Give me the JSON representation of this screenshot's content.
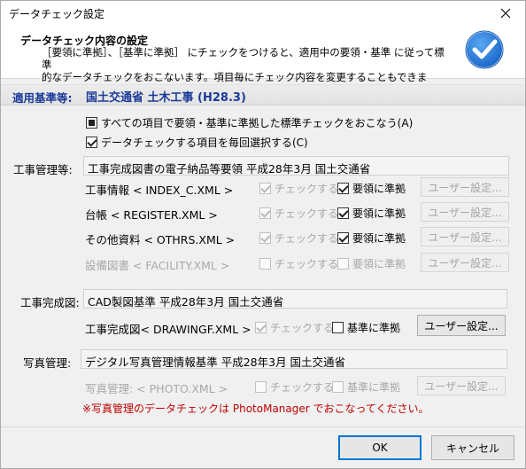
{
  "window": {
    "title": "データチェック設定"
  },
  "header": {
    "title": "データチェック内容の設定",
    "desc_line1": "［要領に準拠］、［基準に準拠］ にチェックをつけると、適用中の要領・基準 に従って標準",
    "desc_line2": "的なデータチェックをおこないます。項目毎にチェック内容を変更することもできます。"
  },
  "standard": {
    "label": "適用基準等:",
    "value": "国土交通省 土木工事 (H28.3)"
  },
  "options": {
    "all_items": "すべての項目で要領・基準に準拠した標準チェックをおこなう(A)",
    "select_each": "データチェックする項目を毎回選択する(C)"
  },
  "koji_kanri": {
    "label": "工事管理等:",
    "field_value": "工事完成図書の電子納品等要領 平成28年3月 国土交通省",
    "rows": [
      {
        "label": "工事情報 < INDEX_C.XML >",
        "check_label": "チェックする",
        "comply_label": "要領に準拠",
        "button": "ユーザー設定..."
      },
      {
        "label": "台帳 < REGISTER.XML >",
        "check_label": "チェックする",
        "comply_label": "要領に準拠",
        "button": "ユーザー設定..."
      },
      {
        "label": "その他資料 < OTHRS.XML >",
        "check_label": "チェックする",
        "comply_label": "要領に準拠",
        "button": "ユーザー設定..."
      },
      {
        "label": "設備図書 < FACILITY.XML >",
        "check_label": "チェックする",
        "comply_label": "要領に準拠",
        "button": "ユーザー設定..."
      }
    ]
  },
  "kansei_zu": {
    "label": "工事完成図:",
    "field_value": "CAD製図基準 平成28年3月 国土交通省",
    "row": {
      "label": "工事完成図< DRAWINGF.XML >",
      "check_label": "チェックする",
      "comply_label": "基準に準拠",
      "button": "ユーザー設定..."
    }
  },
  "shashin": {
    "label": "写真管理:",
    "field_value": "デジタル写真管理情報基準 平成28年3月 国土交通省",
    "row": {
      "label": "写真管理: < PHOTO.XML >",
      "check_label": "チェックする",
      "comply_label": "基準に準拠",
      "button": "ユーザー設定..."
    },
    "note": "※写真管理のデータチェックは PhotoManager でおこなってください。"
  },
  "footer": {
    "ok": "OK",
    "cancel": "キャンセル"
  },
  "colors": {
    "accent_blue": "#1a3a99",
    "badge_blue": "#1e74d6",
    "warning_red": "#c00000"
  }
}
